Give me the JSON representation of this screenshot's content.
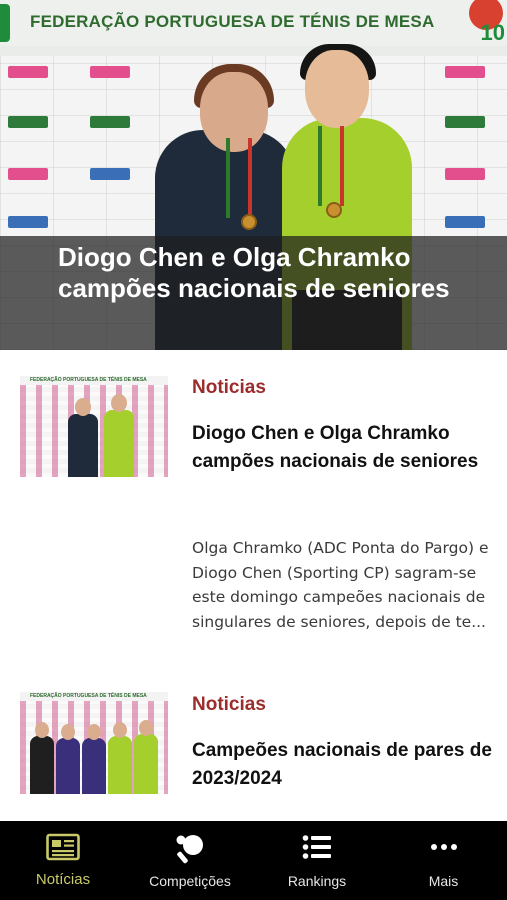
{
  "hero": {
    "banner_text": "FEDERAÇÃO PORTUGUESA DE TÉNIS DE MESA",
    "logo_text": "10",
    "title": "Diogo Chen e Olga Chramko campões nacionais de seniores"
  },
  "news": [
    {
      "thumb_banner": "FEDERAÇÃO PORTUGUESA DE TÉNIS DE MESA",
      "category": "Noticias",
      "title": "Diogo Chen e Olga Chramko campões nacionais de seniores",
      "excerpt": "Olga Chramko (ADC Ponta do Pargo) e Diogo Chen (Sporting CP) sagram-se este domingo campeões nacionais de singulares de seniores, depois de te..."
    },
    {
      "thumb_banner": "FEDERAÇÃO PORTUGUESA DE TÉNIS DE MESA",
      "category": "Noticias",
      "title": "Campeões nacionais de pares de 2023/2024"
    }
  ],
  "tabbar": {
    "tabs": [
      {
        "label": "Notícias",
        "icon": "newspaper-icon",
        "active": true
      },
      {
        "label": "Competições",
        "icon": "ping-pong-icon",
        "active": false
      },
      {
        "label": "Rankings",
        "icon": "list-icon",
        "active": false
      },
      {
        "label": "Mais",
        "icon": "more-dots-icon",
        "active": false
      }
    ]
  },
  "colors": {
    "accent": "#9b2d2d",
    "tab_active": "#c9c96a",
    "tabbar_bg": "#000000"
  }
}
